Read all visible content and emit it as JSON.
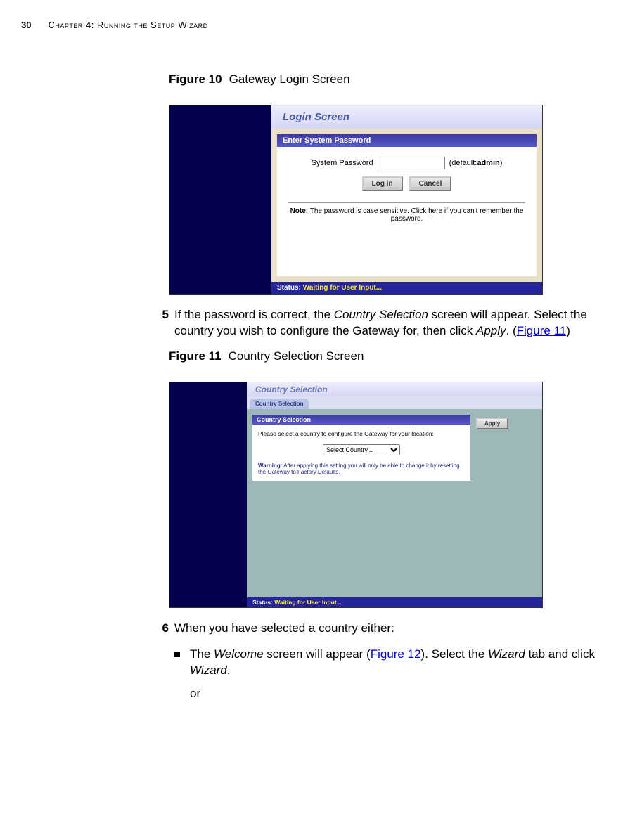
{
  "header": {
    "page_number": "30",
    "chapter": "Chapter 4: Running the Setup Wizard"
  },
  "figure10": {
    "label_num": "Figure 10",
    "label_text": "Gateway Login Screen",
    "screen_title": "Login Screen",
    "panel_header": "Enter System Password",
    "password_label": "System Password",
    "password_default": "(default:",
    "password_default_bold": "admin",
    "password_default_close": ")",
    "login_btn": "Log in",
    "cancel_btn": "Cancel",
    "note_bold": "Note:",
    "note_text": " The password is case sensitive. Click ",
    "note_link": "here",
    "note_text2": " if you can't remember the password.",
    "status_label": "Status:",
    "status_value": "Waiting for User Input..."
  },
  "step5": {
    "num": "5",
    "text_a": "If the password is correct, the ",
    "text_italic1": "Country Selection",
    "text_b": " screen will appear. Select the country you wish to configure the Gateway for, then click ",
    "text_italic2": "Apply",
    "text_c": ". (",
    "link": "Figure 11",
    "text_d": ")"
  },
  "figure11": {
    "label_num": "Figure 11",
    "label_text": "Country Selection Screen",
    "screen_title": "Country Selection",
    "tab_label": "Country Selection",
    "panel_header": "Country Selection",
    "panel_text": "Please select a country to configure the Gateway for your location:",
    "select_placeholder": "Select Country...",
    "warning_bold": "Warning:",
    "warning_text": " After applying this setting you will only be able to change it by resetting the Gateway to Factory Defaults.",
    "apply_btn": "Apply",
    "status_label": "Status:",
    "status_value": "Waiting for User Input..."
  },
  "step6": {
    "num": "6",
    "text": "When you have selected a country either:",
    "bullet_a": "The ",
    "bullet_italic1": "Welcome",
    "bullet_b": " screen will appear (",
    "bullet_link": "Figure 12",
    "bullet_c": "). Select the ",
    "bullet_italic2": "Wizard",
    "bullet_d": " tab and click ",
    "bullet_italic3": "Wizard",
    "bullet_e": ".",
    "or": "or"
  }
}
